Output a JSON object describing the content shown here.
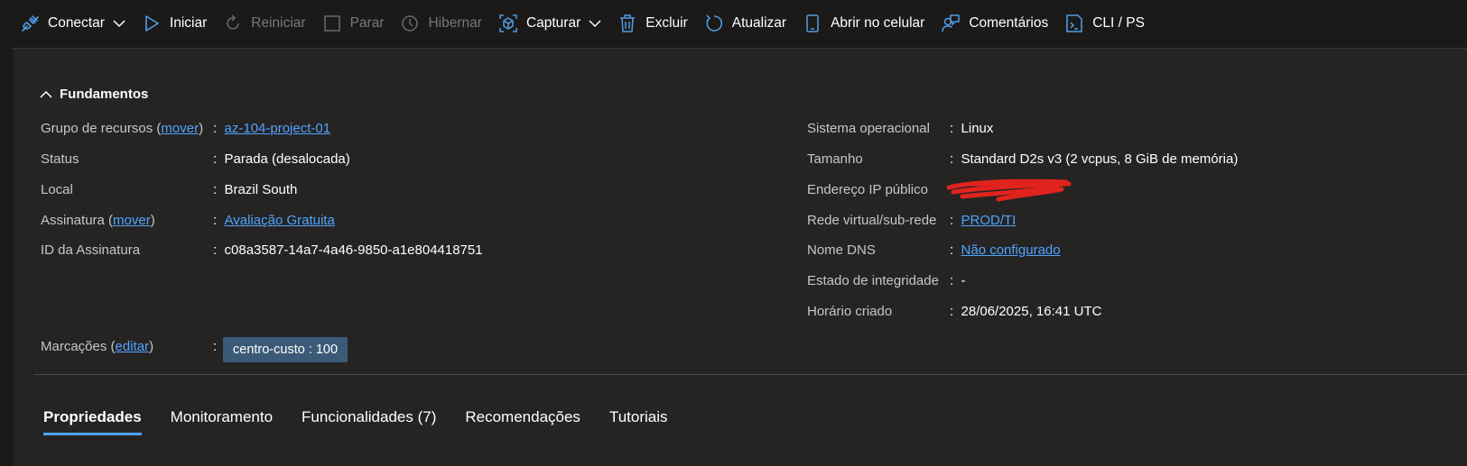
{
  "toolbar": {
    "connect": "Conectar",
    "start": "Iniciar",
    "restart": "Reiniciar",
    "stop": "Parar",
    "hibernate": "Hibernar",
    "capture": "Capturar",
    "delete": "Excluir",
    "refresh": "Atualizar",
    "open_mobile": "Abrir no celular",
    "comments": "Comentários",
    "cli": "CLI / PS"
  },
  "essentials": {
    "title": "Fundamentos",
    "left": {
      "resource_group_label": "Grupo de recursos",
      "resource_group_move": "mover",
      "resource_group_value": "az-104-project-01",
      "status_label": "Status",
      "status_value": "Parada (desalocada)",
      "location_label": "Local",
      "location_value": "Brazil South",
      "subscription_label": "Assinatura",
      "subscription_move": "mover",
      "subscription_value": "Avaliação Gratuita",
      "subscription_id_label": "ID da Assinatura",
      "subscription_id_value": "c08a3587-14a7-4a46-9850-a1e804418751"
    },
    "right": {
      "os_label": "Sistema operacional",
      "os_value": "Linux",
      "size_label": "Tamanho",
      "size_value": "Standard D2s v3 (2 vcpus, 8 GiB de memória)",
      "public_ip_label": "Endereço IP público",
      "vnet_label": "Rede virtual/sub-rede",
      "vnet_value": "PROD/TI",
      "dns_label": "Nome DNS",
      "dns_value": "Não configurado",
      "health_label": "Estado de integridade",
      "health_value": "-",
      "created_label": "Horário criado",
      "created_value": "28/06/2025, 16:41 UTC"
    },
    "tags_label": "Marcações",
    "tags_edit": "editar",
    "tag_value": "centro-custo : 100"
  },
  "tabs": [
    "Propriedades",
    "Monitoramento",
    "Funcionalidades (7)",
    "Recomendações",
    "Tutoriais"
  ],
  "colors": {
    "accent": "#4fa3ff",
    "icon": "#4f9ee8",
    "tag_bg": "#3a5a78",
    "redaction": "#e0231c"
  }
}
